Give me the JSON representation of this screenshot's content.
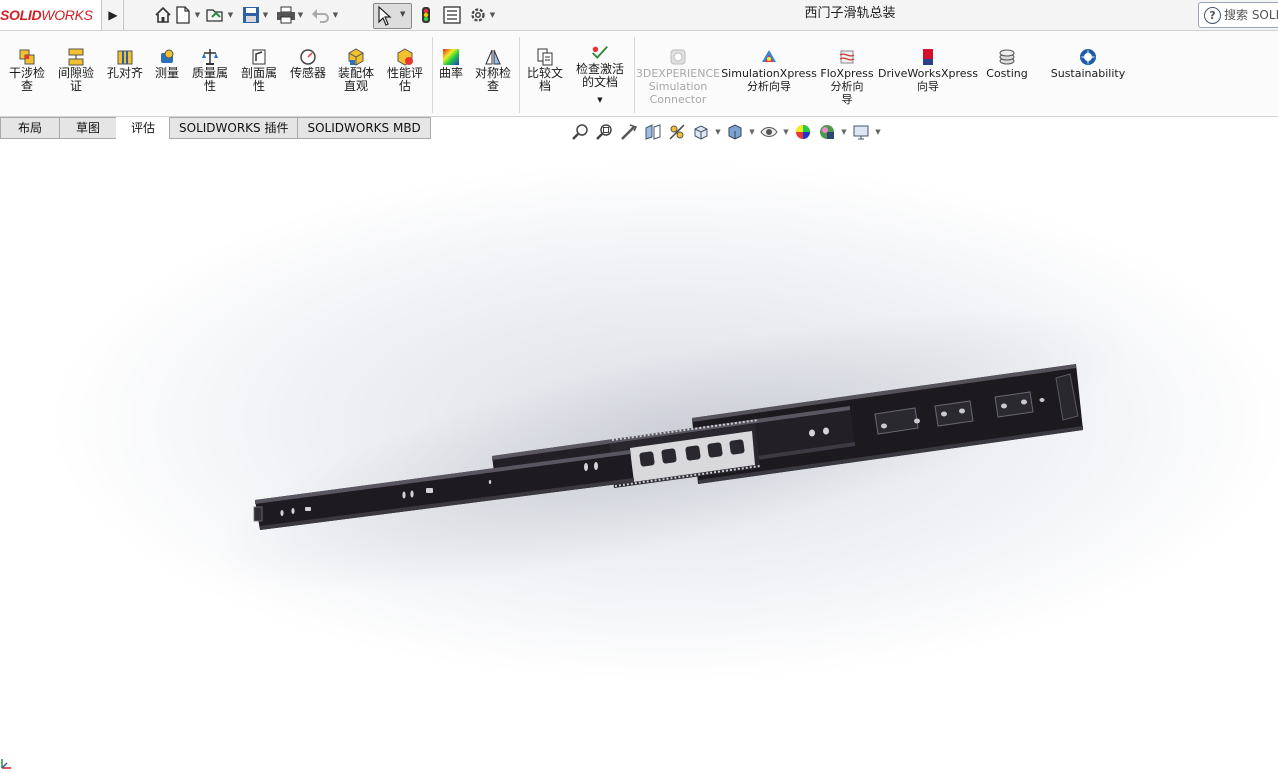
{
  "app": {
    "logo_solid": "SOLID",
    "logo_works": "WORKS",
    "document_title": "西门子滑轨总装",
    "search_label": "搜索 SOLI"
  },
  "quick_access": [
    {
      "name": "home-icon"
    },
    {
      "name": "new-document-icon"
    },
    {
      "name": "open-icon"
    },
    {
      "name": "save-icon"
    },
    {
      "name": "print-icon"
    },
    {
      "name": "undo-icon"
    },
    {
      "name": "select-icon"
    },
    {
      "name": "rebuild-icon"
    },
    {
      "name": "file-properties-icon"
    },
    {
      "name": "options-icon"
    }
  ],
  "ribbon": {
    "interference": [
      "干涉检",
      "查"
    ],
    "clearance": [
      "间隙验",
      "证"
    ],
    "hole_align": [
      "孔对齐"
    ],
    "measure": [
      "测量"
    ],
    "mass_props": [
      "质量属",
      "性"
    ],
    "section_props": [
      "剖面属",
      "性"
    ],
    "sensor": [
      "传感器"
    ],
    "assembly_viz": [
      "装配体",
      "直观"
    ],
    "performance": [
      "性能评",
      "估"
    ],
    "curvature": [
      "曲率"
    ],
    "symmetry": [
      "对称检",
      "查"
    ],
    "compare": [
      "比较文",
      "档"
    ],
    "check_active": [
      "检查激活",
      "的文档"
    ],
    "experience": [
      "3DEXPERIENCE",
      "Simulation",
      "Connector"
    ],
    "simxpress": [
      "SimulationXpress",
      "分析向导"
    ],
    "floxpress": [
      "FloXpress",
      "分析向",
      "导"
    ],
    "driveworks": [
      "DriveWorksXpress",
      "向导"
    ],
    "costing": [
      "Costing"
    ],
    "sustainability": [
      "Sustainability"
    ]
  },
  "tabs": [
    "布局",
    "草图",
    "评估",
    "SOLIDWORKS 插件",
    "SOLIDWORKS MBD"
  ],
  "active_tab": "评估",
  "colors": {
    "brand_red": "#d11f26",
    "model_dark": "#1c1a1f",
    "ball_cage": "#d9d9dc"
  }
}
